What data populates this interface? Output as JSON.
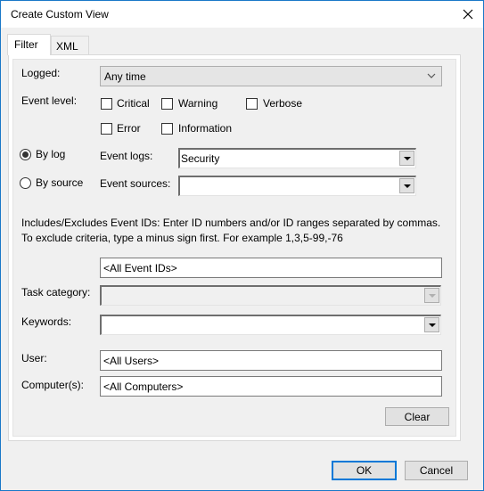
{
  "window": {
    "title": "Create Custom View",
    "close_icon": "close-icon"
  },
  "tabs": [
    {
      "label": "Filter",
      "active": true
    },
    {
      "label": "XML",
      "active": false
    }
  ],
  "filter": {
    "logged": {
      "label": "Logged:",
      "value": "Any time"
    },
    "event_level": {
      "label": "Event level:",
      "options": [
        {
          "label": "Critical",
          "checked": false
        },
        {
          "label": "Warning",
          "checked": false
        },
        {
          "label": "Verbose",
          "checked": false
        },
        {
          "label": "Error",
          "checked": false
        },
        {
          "label": "Information",
          "checked": false
        }
      ]
    },
    "by_log": {
      "label": "By log",
      "selected": true
    },
    "by_source": {
      "label": "By source",
      "selected": false
    },
    "event_logs": {
      "label": "Event logs:",
      "value": "Security"
    },
    "event_sources": {
      "label": "Event sources:",
      "value": ""
    },
    "event_ids_description": "Includes/Excludes Event IDs: Enter ID numbers and/or ID ranges separated by commas. To exclude criteria, type a minus sign first. For example 1,3,5-99,-76",
    "event_ids": {
      "value": "<All Event IDs>"
    },
    "task_category": {
      "label": "Task category:",
      "value": "",
      "disabled": true
    },
    "keywords": {
      "label": "Keywords:",
      "value": ""
    },
    "user": {
      "label": "User:",
      "value": "<All Users>"
    },
    "computers": {
      "label": "Computer(s):",
      "value": "<All Computers>"
    },
    "clear_label": "Clear"
  },
  "footer": {
    "ok_label": "OK",
    "cancel_label": "Cancel"
  }
}
